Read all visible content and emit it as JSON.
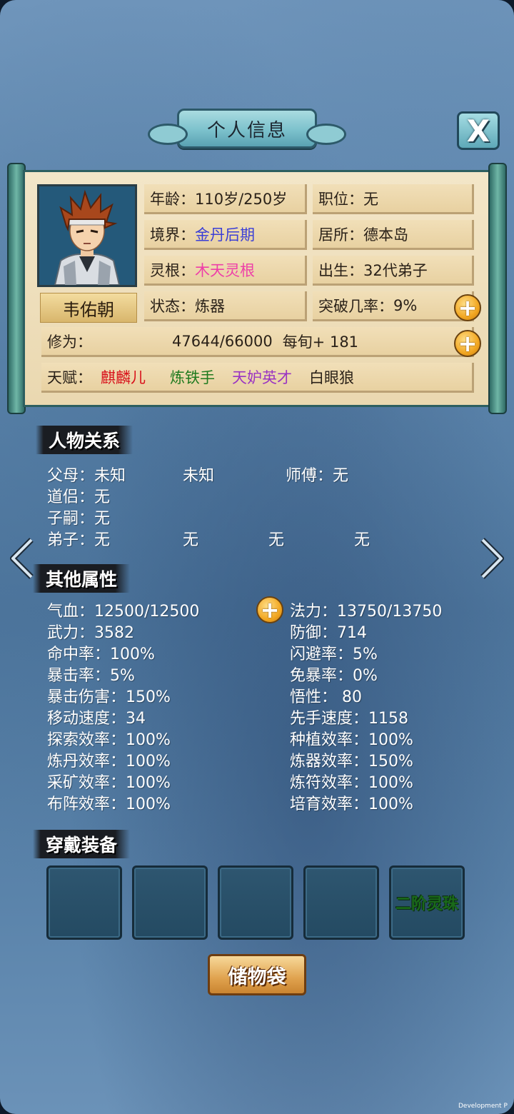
{
  "header": {
    "title": "个人信息",
    "close_label": "X"
  },
  "character": {
    "name": "韦佑朝",
    "age_label": "年龄：",
    "age_value": "110岁/250岁",
    "position_label": "职位：",
    "position_value": "无",
    "realm_label": "境界：",
    "realm_value": "金丹后期",
    "residence_label": "居所：",
    "residence_value": "德本岛",
    "root_label": "灵根：",
    "root_value": "木天灵根",
    "birth_label": "出生：",
    "birth_value": "32代弟子",
    "status_label": "状态：",
    "status_value": "炼器",
    "breakthrough_label": "突破几率：",
    "breakthrough_value": "9%",
    "cultivation_label": "修为：",
    "cultivation_value": "47644/66000",
    "cultivation_rate": "每旬+ 181",
    "talent_label": "天赋：",
    "talents": [
      {
        "text": "麒麟儿",
        "color": "#d8101a"
      },
      {
        "text": "炼铁手",
        "color": "#1f7a1e"
      },
      {
        "text": "天妒英才",
        "color": "#9a34c2"
      },
      {
        "text": "白眼狼",
        "color": "#2a2118"
      }
    ]
  },
  "relations": {
    "heading": "人物关系",
    "parents_label": "父母：",
    "parents": [
      "未知",
      "未知"
    ],
    "master_label": "师傅：",
    "master_value": "无",
    "partner_label": "道侣：",
    "partner_value": "无",
    "children_label": "子嗣：",
    "children_value": "无",
    "disciples_label": "弟子：",
    "disciples": [
      "无",
      "无",
      "无",
      "无"
    ]
  },
  "attributes": {
    "heading": "其他属性",
    "left": [
      "气血：12500/12500",
      "武力：3582",
      "命中率：100%",
      "暴击率：5%",
      "暴击伤害：150%",
      "移动速度：34",
      "探索效率：100%",
      "炼丹效率：100%",
      "采矿效率：100%",
      "布阵效率：100%"
    ],
    "right": [
      "法力：13750/13750",
      "防御：714",
      "闪避率：5%",
      "免暴率：0%",
      "悟性： 80",
      "先手速度：1158",
      "种植效率：100%",
      "炼器效率：150%",
      "炼符效率：100%",
      "培育效率：100%"
    ]
  },
  "equipment": {
    "heading": "穿戴装备",
    "slots": [
      "",
      "",
      "",
      "",
      "二阶灵珠"
    ]
  },
  "bag_button": "储物袋",
  "plus_icon": "+",
  "footer_text": "Development P"
}
